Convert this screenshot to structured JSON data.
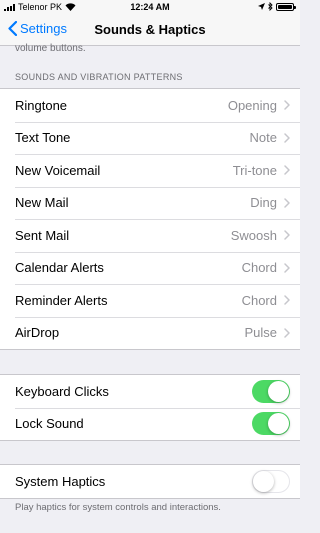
{
  "status_bar": {
    "carrier": "Telenor PK",
    "time": "12:24 AM",
    "battery_level": 1.0
  },
  "nav": {
    "back_label": "Settings",
    "title": "Sounds & Haptics"
  },
  "scroll_note": "volume buttons.",
  "patterns": {
    "header": "SOUNDS AND VIBRATION PATTERNS",
    "items": [
      {
        "label": "Ringtone",
        "value": "Opening"
      },
      {
        "label": "Text Tone",
        "value": "Note"
      },
      {
        "label": "New Voicemail",
        "value": "Tri-tone"
      },
      {
        "label": "New Mail",
        "value": "Ding"
      },
      {
        "label": "Sent Mail",
        "value": "Swoosh"
      },
      {
        "label": "Calendar Alerts",
        "value": "Chord"
      },
      {
        "label": "Reminder Alerts",
        "value": "Chord"
      },
      {
        "label": "AirDrop",
        "value": "Pulse"
      }
    ]
  },
  "toggles": {
    "keyboard_clicks": {
      "label": "Keyboard Clicks",
      "on": true
    },
    "lock_sound": {
      "label": "Lock Sound",
      "on": true
    }
  },
  "haptics": {
    "label": "System Haptics",
    "on": false,
    "footer": "Play haptics for system controls and interactions."
  },
  "colors": {
    "accent": "#007aff",
    "switch_on": "#4cd964",
    "background": "#efeff4"
  }
}
